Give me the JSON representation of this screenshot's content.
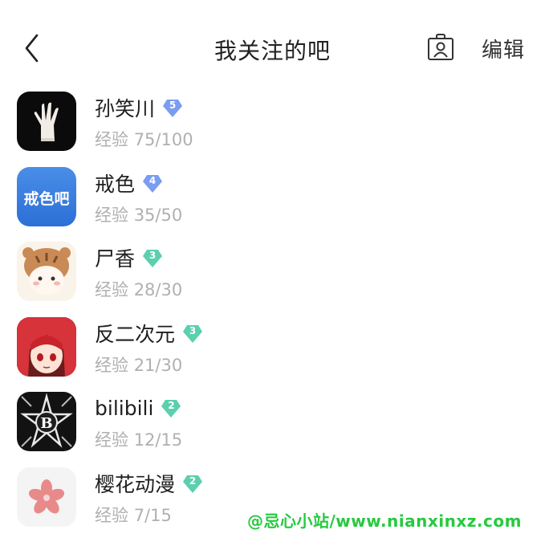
{
  "header": {
    "title": "我关注的吧",
    "edit_label": "编辑",
    "back_icon": "chevron-left-icon",
    "profile_icon": "user-badge-icon"
  },
  "exp_prefix": "经验",
  "forums": [
    {
      "name": "孙笑川",
      "level": "5",
      "exp": "75/100",
      "badge_color": "#7b9cf0"
    },
    {
      "name": "戒色",
      "level": "4",
      "exp": "35/50",
      "badge_color": "#7b9cf0",
      "avatar_text": "戒色吧"
    },
    {
      "name": "尸香",
      "level": "3",
      "exp": "28/30",
      "badge_color": "#5ccfae"
    },
    {
      "name": "反二次元",
      "level": "3",
      "exp": "21/30",
      "badge_color": "#5ccfae"
    },
    {
      "name": "bilibili",
      "level": "2",
      "exp": "12/15",
      "badge_color": "#5ccfae"
    },
    {
      "name": "樱花动漫",
      "level": "2",
      "exp": "7/15",
      "badge_color": "#5ccfae"
    }
  ],
  "watermark": "@忌心小站/www.nianxinxz.com"
}
